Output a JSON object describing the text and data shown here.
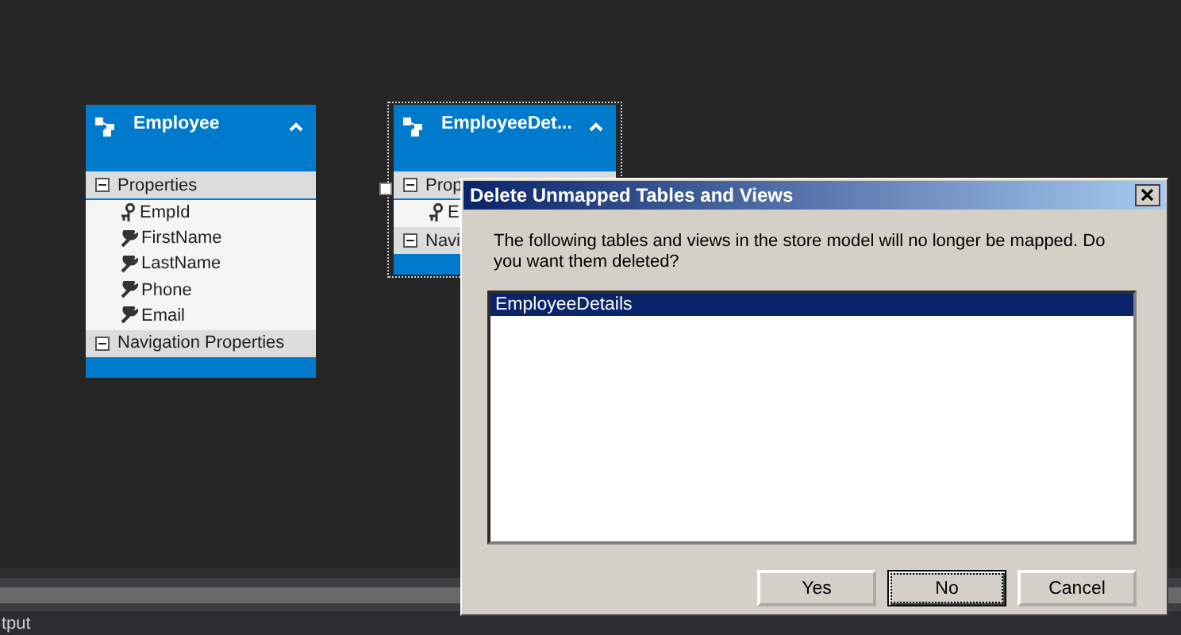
{
  "entities": [
    {
      "title": "Employee",
      "selected": false,
      "sections": [
        {
          "label": "Properties",
          "expanded": true,
          "items": [
            {
              "kind": "key",
              "name": "EmpId"
            },
            {
              "kind": "property",
              "name": "FirstName"
            },
            {
              "kind": "property",
              "name": "LastName"
            },
            {
              "kind": "property",
              "name": "Phone"
            },
            {
              "kind": "property",
              "name": "Email"
            }
          ]
        },
        {
          "label": "Navigation Properties",
          "expanded": true
        }
      ]
    },
    {
      "title": "EmployeeDet...",
      "selected": true,
      "sections": [
        {
          "label": "Prop",
          "expanded": true,
          "items": [
            {
              "kind": "key",
              "name": "E"
            }
          ]
        },
        {
          "label": "Navi",
          "expanded": true
        }
      ]
    }
  ],
  "dialog": {
    "title": "Delete Unmapped Tables and Views",
    "message": "The following tables and views in the store model will no longer be mapped.  Do you want them deleted?",
    "list": [
      {
        "label": "EmployeeDetails",
        "selected": true
      }
    ],
    "buttons": [
      {
        "label": "Yes",
        "focused": false
      },
      {
        "label": "No",
        "focused": true
      },
      {
        "label": "Cancel",
        "focused": false
      }
    ]
  },
  "output_panel": {
    "label": "tput"
  }
}
